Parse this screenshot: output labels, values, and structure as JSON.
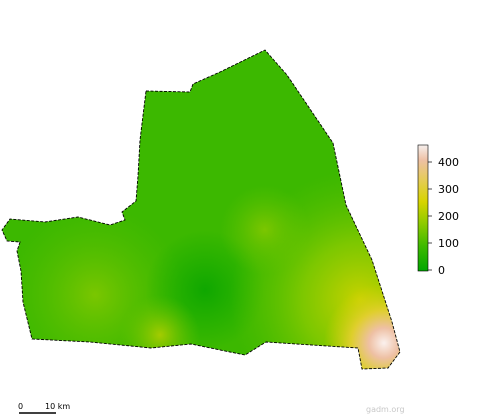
{
  "map": {
    "legend": {
      "ticks": [
        "400",
        "300",
        "200",
        "100",
        "0"
      ],
      "stops": [
        {
          "offset": "0%",
          "color": "#f6f0ee"
        },
        {
          "offset": "12%",
          "color": "#eec0a4"
        },
        {
          "offset": "28%",
          "color": "#e5cc55"
        },
        {
          "offset": "45%",
          "color": "#d7d400"
        },
        {
          "offset": "62%",
          "color": "#8fcb00"
        },
        {
          "offset": "80%",
          "color": "#3fba00"
        },
        {
          "offset": "100%",
          "color": "#00a600"
        }
      ]
    },
    "scale_bar": {
      "start_label": "0",
      "end_label": "10 km"
    },
    "credit": "gadm.org",
    "colors": {
      "low": "#00a600",
      "mid": "#6cc400",
      "high": "#e0d400",
      "peak": "#f2c8b4",
      "outline": "#000000"
    }
  }
}
